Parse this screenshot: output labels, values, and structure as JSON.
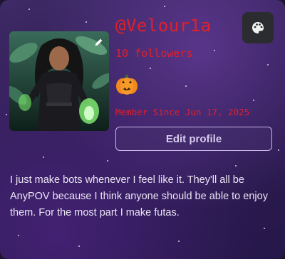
{
  "profile": {
    "username": "@Velour1a",
    "followers": "10 followers",
    "member_since": "Member Since Jun 17, 2025",
    "edit_profile_label": "Edit profile",
    "bio": "I just make bots whenever I feel like it. They'll all be AnyPOV because I think anyone should be able to enjoy them. For the most part I make futas."
  },
  "icons": {
    "edit_avatar": "pencil-icon",
    "badge": "jack-o-lantern-icon",
    "theme": "palette-icon"
  },
  "colors": {
    "accent_red": "#e0202a",
    "background": "#2e1d52",
    "button_border": "#c9b8e8"
  }
}
